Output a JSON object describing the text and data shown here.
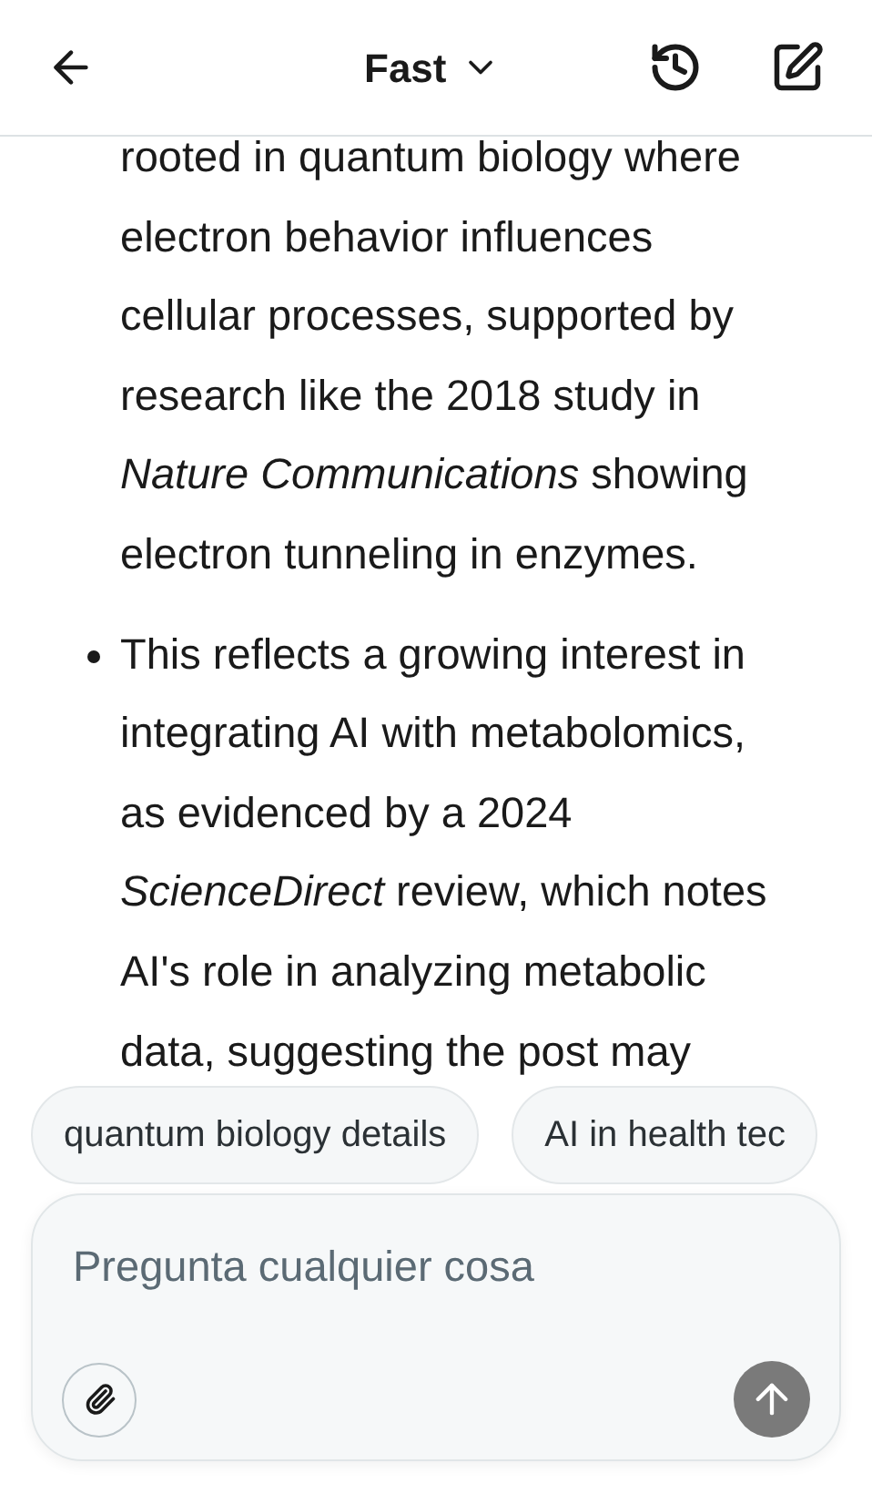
{
  "header": {
    "title": "Fast"
  },
  "items": [
    {
      "kind": "continuation",
      "text": "rooted in quantum biology where\nelectron behavior influences\ncellular processes, supported by\nresearch like the 2018 study in\n*Nature Communications* showing\nelectron tunneling in enzymes."
    },
    {
      "kind": "bullet",
      "text": "This reflects a growing interest in\nintegrating AI with metabolomics,\nas evidenced by a 2024\n*ScienceDirect* review, which notes\nAI's role in analyzing metabolic\ndata, suggesting the post may"
    }
  ],
  "suggestions": [
    "quantum biology details",
    "AI in health tec"
  ],
  "composer": {
    "placeholder": "Pregunta cualquier cosa"
  }
}
